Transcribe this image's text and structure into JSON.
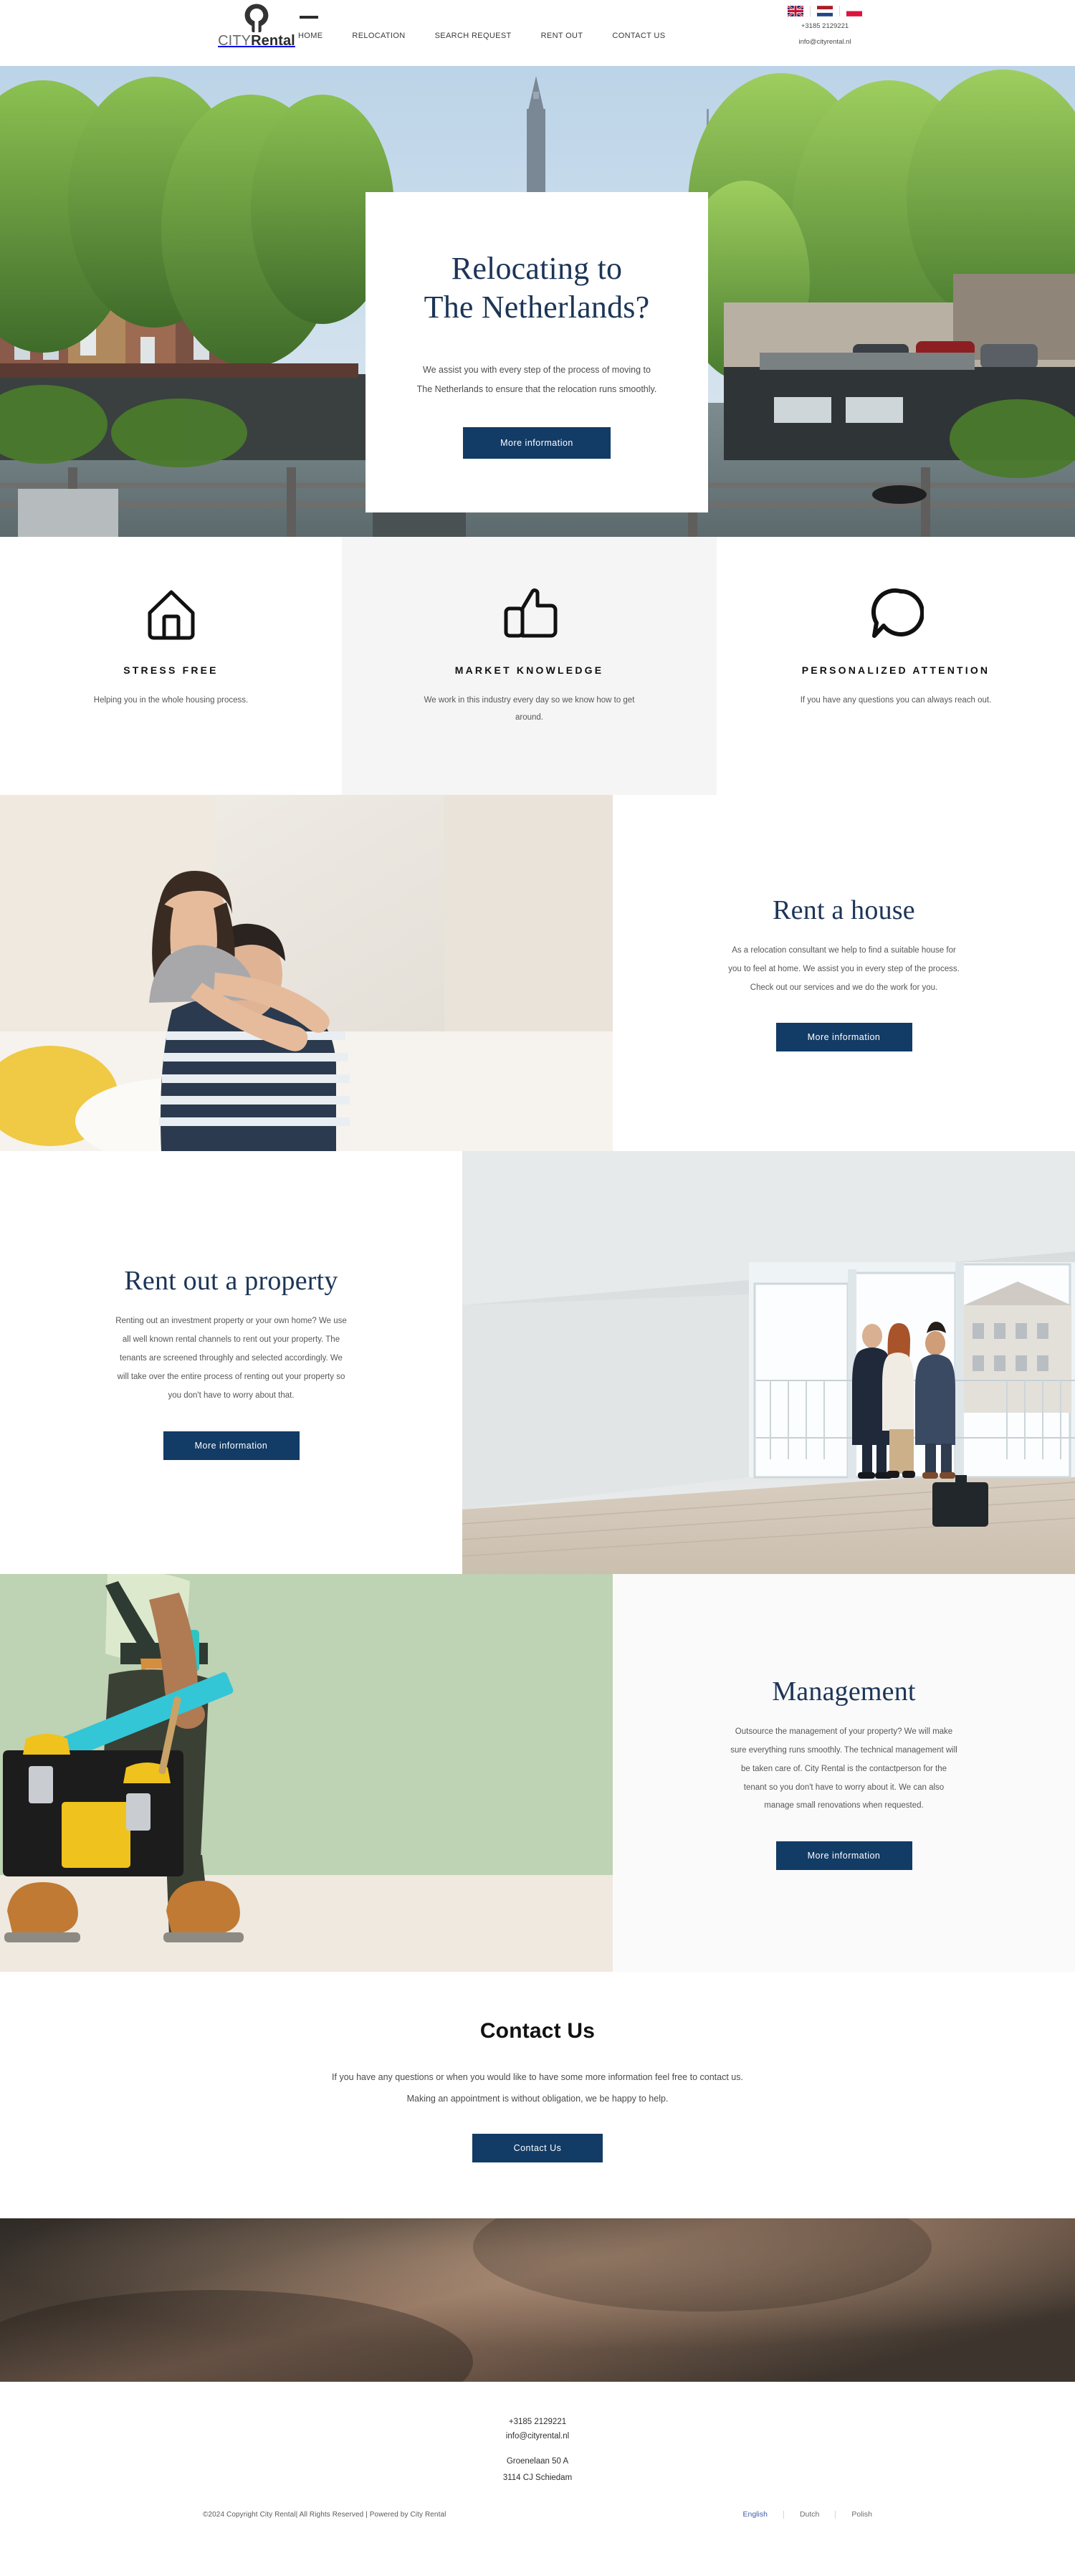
{
  "brand": {
    "logo_icon": "keyhole-logo-icon",
    "name_light": "CITY",
    "name_bold": "Rental"
  },
  "nav": {
    "items": [
      {
        "label": "HOME",
        "name": "nav-item-home"
      },
      {
        "label": "RELOCATION",
        "name": "nav-item-relocation"
      },
      {
        "label": "SEARCH REQUEST",
        "name": "nav-item-search-request"
      },
      {
        "label": "RENT OUT",
        "name": "nav-item-rent-out"
      },
      {
        "label": "CONTACT US",
        "name": "nav-item-contact-us"
      }
    ]
  },
  "utility": {
    "flags": [
      {
        "name": "flag-united-kingdom",
        "label": "English"
      },
      {
        "name": "flag-netherlands",
        "label": "Dutch"
      },
      {
        "name": "flag-poland",
        "label": "Polish"
      }
    ],
    "phone": "+3185 2129221",
    "email": "info@cityrental.nl"
  },
  "hero": {
    "image": "amsterdam-canal-houseboats-photo",
    "title_line1": "Relocating to",
    "title_line2": "The Netherlands?",
    "subtitle": "We assist you with every step of the process of moving to The Netherlands to ensure that the relocation runs smoothly.",
    "button": "More information"
  },
  "features": [
    {
      "icon": "house-outline-icon",
      "title": "STRESS FREE",
      "desc": "Helping you in the whole housing process."
    },
    {
      "icon": "thumbs-up-outline-icon",
      "title": "MARKET KNOWLEDGE",
      "desc": "We work in this industry every day so we know how to get around."
    },
    {
      "icon": "speech-bubble-outline-icon",
      "title": "PERSONALIZED ATTENTION",
      "desc": "If you have any questions you can always reach out."
    }
  ],
  "sections": [
    {
      "key": "rent-a-house",
      "image": "couple-embracing-on-sofa-photo",
      "title": "Rent a house",
      "body": "As a relocation consultant we help to find a suitable house for you to feel at home. We assist you in every step of the process. Check out our services and we do the work for you.",
      "button": "More information"
    },
    {
      "key": "rent-out-a-property",
      "image": "empty-white-apartment-with-balcony-photo",
      "title": "Rent out a property",
      "body": "Renting out an investment property or your own home? We use all well known rental channels to rent out your property. The tenants are screened throughly and selected accordingly. We will take over the entire process of renting out your property so you don't have to worry about that.",
      "button": "More information"
    },
    {
      "key": "management",
      "image": "handyman-with-toolbox-and-level-photo",
      "title": "Management",
      "body": "Outsource the management of your property? We will make sure everything runs smoothly. The technical management will be taken care of. City Rental is the contactperson for the tenant so you don't have to worry about it. We can also manage small renovations when requested.",
      "button": "More information"
    }
  ],
  "contact": {
    "title": "Contact Us",
    "line1": "If you have any questions or when you would like to have some more information feel free to contact us.",
    "line2": "Making an appointment is without obligation, we be happy to help.",
    "button": "Contact Us"
  },
  "banner": {
    "image": "blurred-warm-interior-photo"
  },
  "footer": {
    "phone": "+3185 2129221",
    "email": "info@cityrental.nl",
    "address_line1": "Groenelaan 50 A",
    "address_line2": "3114 CJ Schiedam",
    "copyright": "©2024 Copyright City Rental| All Rights Reserved | Powered by City Rental",
    "languages": [
      {
        "label": "English",
        "active": true
      },
      {
        "label": "Dutch",
        "active": false
      },
      {
        "label": "Polish",
        "active": false
      }
    ]
  },
  "colors": {
    "navy": "#123b66",
    "heading_navy": "#1c3557",
    "link_blue": "#3c5ea8",
    "feature_band": "#f5f5f5"
  }
}
